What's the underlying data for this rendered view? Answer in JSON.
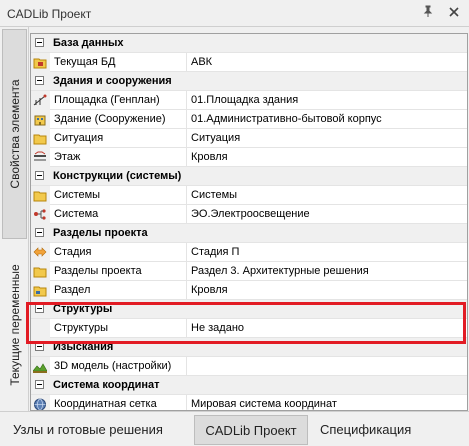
{
  "window": {
    "title": "CADLib Проект",
    "pin_glyph": "📌",
    "close_glyph": "✕"
  },
  "side_tabs": [
    {
      "label": "Свойства элемента",
      "active": true
    },
    {
      "label": "Текущие переменные",
      "active": false
    }
  ],
  "grid": {
    "rows": [
      {
        "kind": "category",
        "label": "База данных"
      },
      {
        "kind": "prop",
        "icon": "database-folder-icon",
        "name": "Текущая БД",
        "value": "АВК"
      },
      {
        "kind": "category",
        "label": "Здания и сооружения"
      },
      {
        "kind": "prop",
        "icon": "site-plan-icon",
        "name": "Площадка (Генплан)",
        "value": "01.Площадка здания"
      },
      {
        "kind": "prop",
        "icon": "building-icon",
        "name": "Здание (Сооружение)",
        "value": "01.Административно-бытовой корпус"
      },
      {
        "kind": "prop",
        "icon": "folder-icon",
        "name": "Ситуация",
        "value": "Ситуация"
      },
      {
        "kind": "prop",
        "icon": "floor-icon",
        "name": "Этаж",
        "value": "Кровля"
      },
      {
        "kind": "category",
        "label": "Конструкции (системы)"
      },
      {
        "kind": "prop",
        "icon": "folder-icon",
        "name": "Системы",
        "value": "Системы"
      },
      {
        "kind": "prop",
        "icon": "system-network-icon",
        "name": "Система",
        "value": "ЭО.Электроосвещение"
      },
      {
        "kind": "category",
        "label": "Разделы проекта"
      },
      {
        "kind": "prop",
        "icon": "stage-arrows-icon",
        "name": "Стадия",
        "value": "Стадия П"
      },
      {
        "kind": "prop",
        "icon": "folder-icon",
        "name": "Разделы проекта",
        "value": "Раздел 3. Архитектурные решения"
      },
      {
        "kind": "prop",
        "icon": "section-folder-icon",
        "name": "Раздел",
        "value": "Кровля"
      },
      {
        "kind": "category",
        "label": "Структуры"
      },
      {
        "kind": "prop",
        "icon": "",
        "name": "Структуры",
        "value": "Не задано"
      },
      {
        "kind": "category",
        "label": "Изыскания"
      },
      {
        "kind": "prop",
        "icon": "terrain-model-icon",
        "name": "3D модель (настройки)",
        "value": ""
      },
      {
        "kind": "category",
        "label": "Система координат"
      },
      {
        "kind": "prop",
        "icon": "globe-icon",
        "name": "Координатная сетка",
        "value": "Мировая система координат"
      }
    ]
  },
  "bottom_tabs": [
    {
      "label": "Узлы и готовые решения",
      "active": false
    },
    {
      "label": "CADLib Проект",
      "active": true
    },
    {
      "label": "Спецификация",
      "active": false
    }
  ],
  "colors": {
    "highlight": "#e21b24",
    "category_bg": "#f0f0f0",
    "chrome": "#f0f0f0"
  }
}
